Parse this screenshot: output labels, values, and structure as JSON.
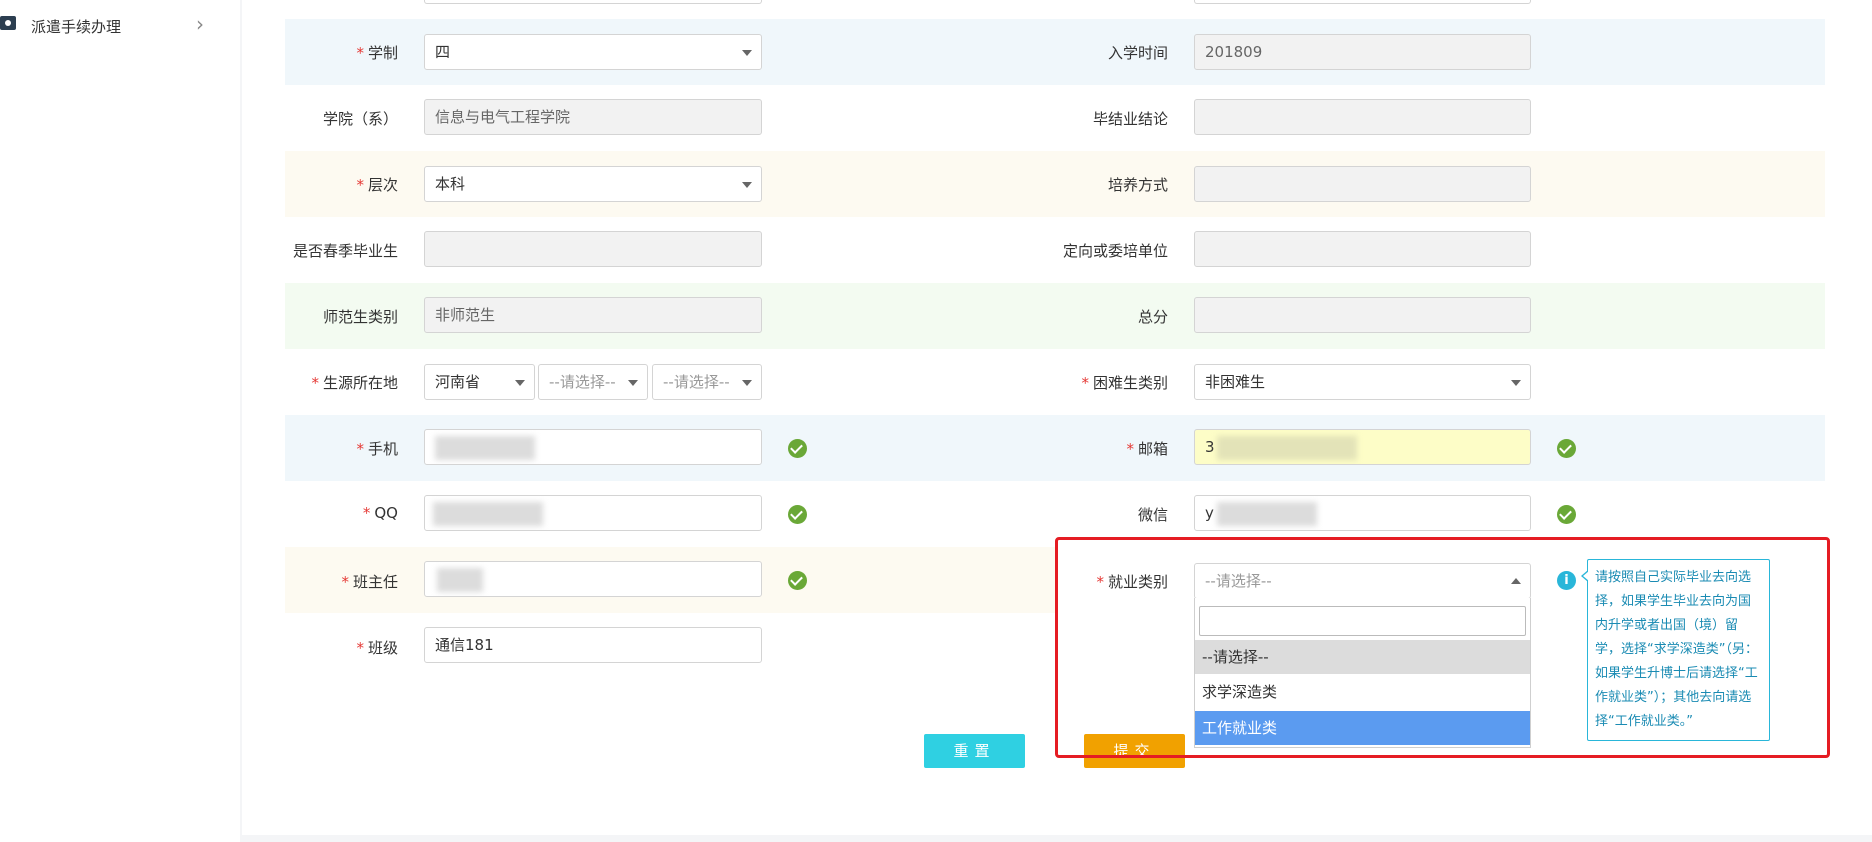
{
  "sidebar": {
    "item_label": "派遣手续办理",
    "item_icon": "id-card-icon",
    "arrow_icon": "chevron-right-icon"
  },
  "form": {
    "xuezhi": {
      "label": "学制",
      "value": "四"
    },
    "ruxue": {
      "label": "入学时间",
      "value": "201809"
    },
    "xueyuan": {
      "label": "学院（系）",
      "value": "信息与电气工程学院"
    },
    "jielun": {
      "label": "毕结业结论",
      "value": ""
    },
    "cengci": {
      "label": "层次",
      "value": "本科"
    },
    "peiyang": {
      "label": "培养方式",
      "value": ""
    },
    "chunji": {
      "label": "是否春季毕业生",
      "value": ""
    },
    "dingxiang": {
      "label": "定向或委培单位",
      "value": ""
    },
    "shifan": {
      "label": "师范生类别",
      "value": "非师范生"
    },
    "zongfen": {
      "label": "总分",
      "value": ""
    },
    "shengyuan": {
      "label": "生源所在地",
      "province": "河南省",
      "city_placeholder": "--请选择--",
      "county_placeholder": "--请选择--"
    },
    "kunnan": {
      "label": "困难生类别",
      "value": "非困难生"
    },
    "shouji": {
      "label": "手机"
    },
    "youxiang": {
      "label": "邮箱",
      "value_prefix": "3"
    },
    "qq": {
      "label": "QQ"
    },
    "weixin": {
      "label": "微信",
      "value_prefix": "y"
    },
    "banzhuren": {
      "label": "班主任"
    },
    "jiuye": {
      "label": "就业类别",
      "placeholder": "--请选择--",
      "options": [
        "--请选择--",
        "求学深造类",
        "工作就业类"
      ],
      "highlighted_option": "工作就业类",
      "tip": "请按照自己实际毕业去向选择，如果学生毕业去向为国内升学或者出国（境）留学，选择“求学深造类”（另：如果学生升博士后请选择“工作就业类”）；其他去向请选择“工作就业类。”"
    },
    "banji": {
      "label": "班级",
      "value": "通信181"
    },
    "required_mark": "*"
  },
  "buttons": {
    "reset": "重置",
    "submit": "提交"
  },
  "colors": {
    "valid_check": "#6aa837",
    "highlight_box": "#e51c23",
    "option_active": "#5b9bf0",
    "reset_button": "#2fd0e2",
    "submit_button": "#f1a100",
    "tip_text": "#1a8bb3"
  }
}
